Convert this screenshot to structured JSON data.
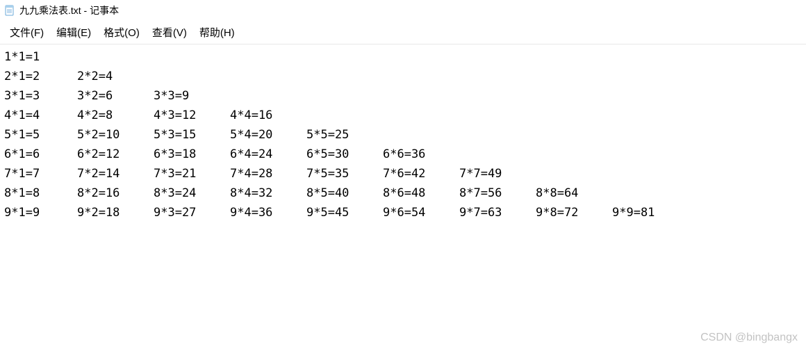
{
  "window": {
    "title": "九九乘法表.txt - 记事本",
    "icon_name": "notepad-icon"
  },
  "menu": {
    "items": [
      {
        "label": "文件(F)"
      },
      {
        "label": "编辑(E)"
      },
      {
        "label": "格式(O)"
      },
      {
        "label": "查看(V)"
      },
      {
        "label": "帮助(H)"
      }
    ]
  },
  "content": {
    "rows": [
      [
        "1*1=1"
      ],
      [
        "2*1=2",
        "2*2=4"
      ],
      [
        "3*1=3",
        "3*2=6",
        "3*3=9"
      ],
      [
        "4*1=4",
        "4*2=8",
        "4*3=12",
        "4*4=16"
      ],
      [
        "5*1=5",
        "5*2=10",
        "5*3=15",
        "5*4=20",
        "5*5=25"
      ],
      [
        "6*1=6",
        "6*2=12",
        "6*3=18",
        "6*4=24",
        "6*5=30",
        "6*6=36"
      ],
      [
        "7*1=7",
        "7*2=14",
        "7*3=21",
        "7*4=28",
        "7*5=35",
        "7*6=42",
        "7*7=49"
      ],
      [
        "8*1=8",
        "8*2=16",
        "8*3=24",
        "8*4=32",
        "8*5=40",
        "8*6=48",
        "8*7=56",
        "8*8=64"
      ],
      [
        "9*1=9",
        "9*2=18",
        "9*3=27",
        "9*4=36",
        "9*5=45",
        "9*6=54",
        "9*7=63",
        "9*8=72",
        "9*9=81"
      ]
    ]
  },
  "watermark": "CSDN @bingbangx"
}
